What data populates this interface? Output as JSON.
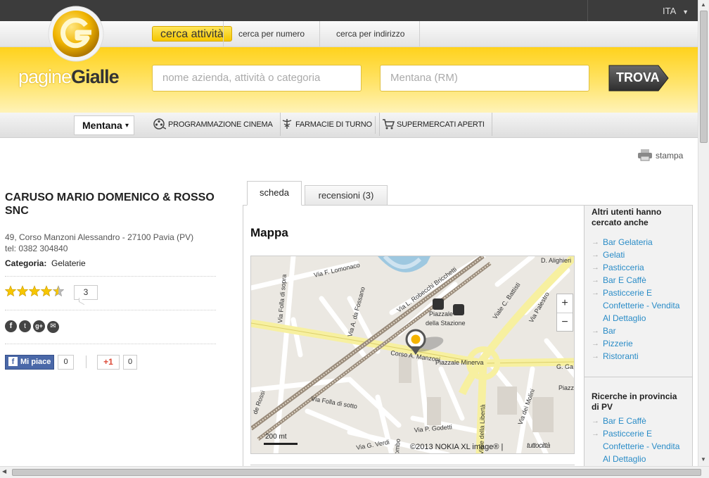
{
  "header": {
    "lang": "ITA",
    "lang_caret": "▼"
  },
  "logo": {
    "letter": "G",
    "text_part1": "pagine",
    "text_part2": "Gialle"
  },
  "search_tabs": [
    "cerca attività",
    "cerca per numero",
    "cerca per indirizzo"
  ],
  "search": {
    "what_placeholder": "nome azienda, attività o categoria",
    "where_placeholder": "Mentana (RM)",
    "button": "TROVA"
  },
  "nav": {
    "city": "Mentana",
    "city_caret": "▾",
    "links": [
      "PROGRAMMAZIONE CINEMA",
      "FARMACIE DI TURNO",
      "SUPERMERCATI APERTI"
    ]
  },
  "print_label": "stampa",
  "business": {
    "name": "CARUSO MARIO DOMENICO & ROSSO SNC",
    "address": "49, Corso Manzoni Alessandro - 27100 Pavia (PV)",
    "tel": "tel: 0382 304840",
    "category_label": "Categoria:",
    "category": "Gelaterie",
    "rating": 4.5,
    "reviews_count": "3",
    "like_label": "Mi piace",
    "like_count": "0",
    "gplus_label": "+1",
    "gplus_count": "0"
  },
  "tabs": {
    "scheda": "scheda",
    "recensioni": "recensioni (3)"
  },
  "map": {
    "title": "Mappa",
    "zoom_in": "+",
    "zoom_out": "−",
    "scale": "200 mt",
    "copyright": "©2013 NOKIA XL image® |",
    "brand": "tuttocittà",
    "labels": [
      "Via F. Lomonaco",
      "Via L. Robecchi Bricchetti",
      "Via Folla di sopra",
      "Via A. da Fossano",
      "Piazzale della Stazione",
      "Viale C. Battisti",
      "Via Palestro",
      "Corso A. Manzoni",
      "Piazzale Minerva",
      "Viale della Libertà",
      "Via Folla di sotto",
      "Via P. Godetti",
      "Via G. Verdi",
      "Via dei Molini",
      "D. Alighieri",
      "G. Ga",
      "Piazz Tribu",
      "de Rossi",
      "ombo"
    ]
  },
  "sidebar": {
    "title1": "Altri utenti hanno cercato anche",
    "list1": [
      "Bar Gelateria",
      "Gelati",
      "Pasticceria",
      "Bar E Caffè",
      "Pasticcerie E Confetterie - Vendita Al Dettaglio",
      "Bar",
      "Pizzerie",
      "Ristoranti"
    ],
    "title2": "Ricerche in provincia di PV",
    "list2": [
      "Bar E Caffè",
      "Pasticcerie E Confetterie - Vendita Al Dettaglio"
    ]
  },
  "colors": {
    "yellow": "#ffd21c",
    "link": "#2a8cc7",
    "topbar": "#3c3c3c"
  }
}
